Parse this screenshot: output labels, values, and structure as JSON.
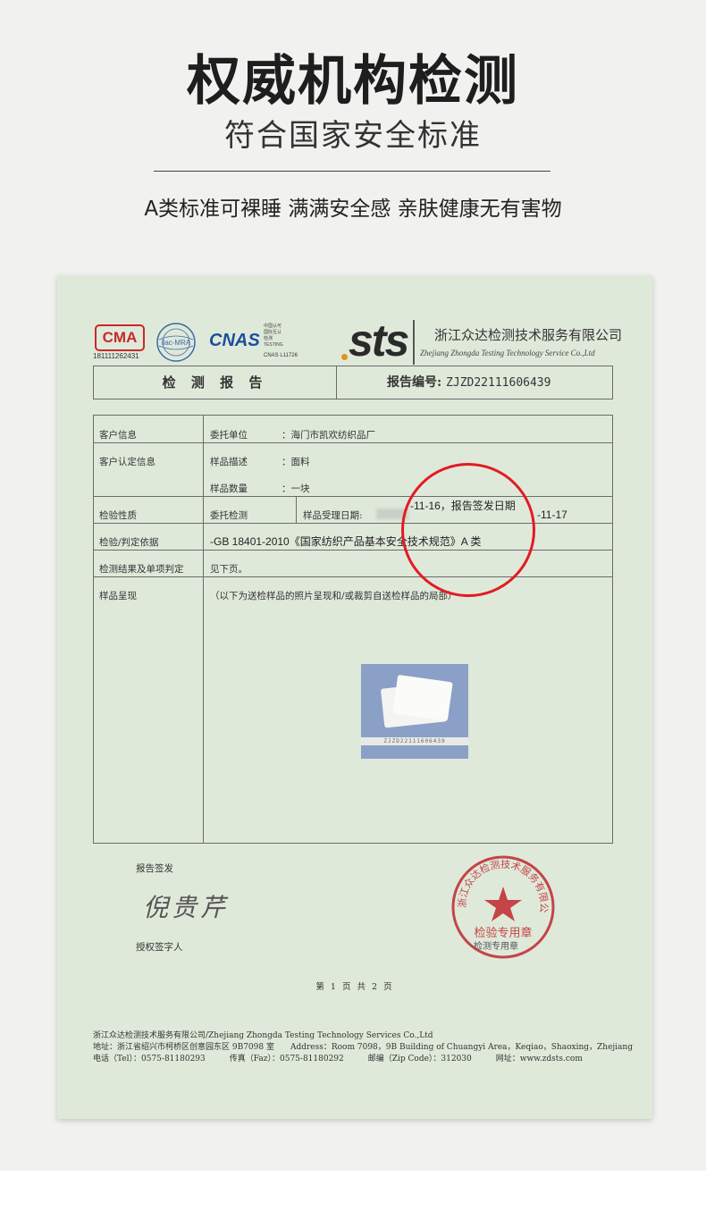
{
  "header": {
    "headline": "权威机构检测",
    "subhead": "符合国家安全标准",
    "tagline": "A类标准可裸睡 满满安全感 亲肤健康无有害物"
  },
  "certificate": {
    "logos": {
      "cma": "CMA",
      "cma_number": "181111262431",
      "ilac": "ilac-MRA",
      "cnas": "CNAS",
      "cnas_text": [
        "中国认可",
        "国际互认",
        "检测",
        "TESTING"
      ],
      "cnas_number": "CNAS L11726",
      "sts": "sts"
    },
    "org_cn": "浙江众达检测技术服务有限公司",
    "org_en": "Zhejiang Zhongda Testing Technology Service Co.,Ltd",
    "report_title": "检 测 报 告",
    "report_no_label": "报告编号:",
    "report_no": "ZJZD22111606439",
    "rows": {
      "client_info": "客户信息",
      "client_confirm": "客户认定信息",
      "test_nature": "检验性质",
      "basis": "检验/判定依据",
      "result": "检测结果及单项判定",
      "sample_show": "样品呈现"
    },
    "fields": {
      "entrust_unit_label": "委托单位",
      "entrust_unit_value": "：海门市凯欢纺织品厂",
      "sample_desc_label": "样品描述",
      "sample_desc_value": "：面料",
      "sample_qty_label": "样品数量",
      "sample_qty_value": "：一块",
      "test_type": "委托检测",
      "accept_date_label": "样品受理日期:",
      "accept_date_value": "-11-16，报告签发日期",
      "issue_date_value": "-11-17",
      "basis_value": "-GB 18401-2010《国家纺织产品基本安全技术规范》A 类",
      "result_value": "见下页。",
      "sample_show_value": "（以下为送检样品的照片呈现和/或裁剪自送检样品的局部）",
      "photo_strip": "ZJZD22111606439"
    },
    "signature": {
      "issue_label": "报告签发",
      "signature_name": "倪贵芹",
      "authorized_label": "授权签字人",
      "seal_text": "浙江众达检测技术服务有限公司",
      "seal_center": "检验专用章",
      "seal_label": "检测专用章"
    },
    "page_no": "第 1 页 共 2 页",
    "footer": {
      "line1": "浙江众达检测技术服务有限公司/Zhejiang Zhongda Testing Technology Services Co.,Ltd",
      "line2": "地址：浙江省绍兴市柯桥区创意园东区 9B7098 室　　Address：Room 7098，9B Building of Chuangyi Area，Keqiao，Shaoxing，Zhejiang",
      "line3": "电话（Tel）：0575-81180293　　　传真（Faz）：0575-81180292　　　邮编（Zip Code）：312030　　　网址：www.zdsts.com"
    }
  },
  "colors": {
    "sheet": "#dfe9da",
    "highlight_circle": "#e31b23",
    "seal": "#c0272d"
  }
}
